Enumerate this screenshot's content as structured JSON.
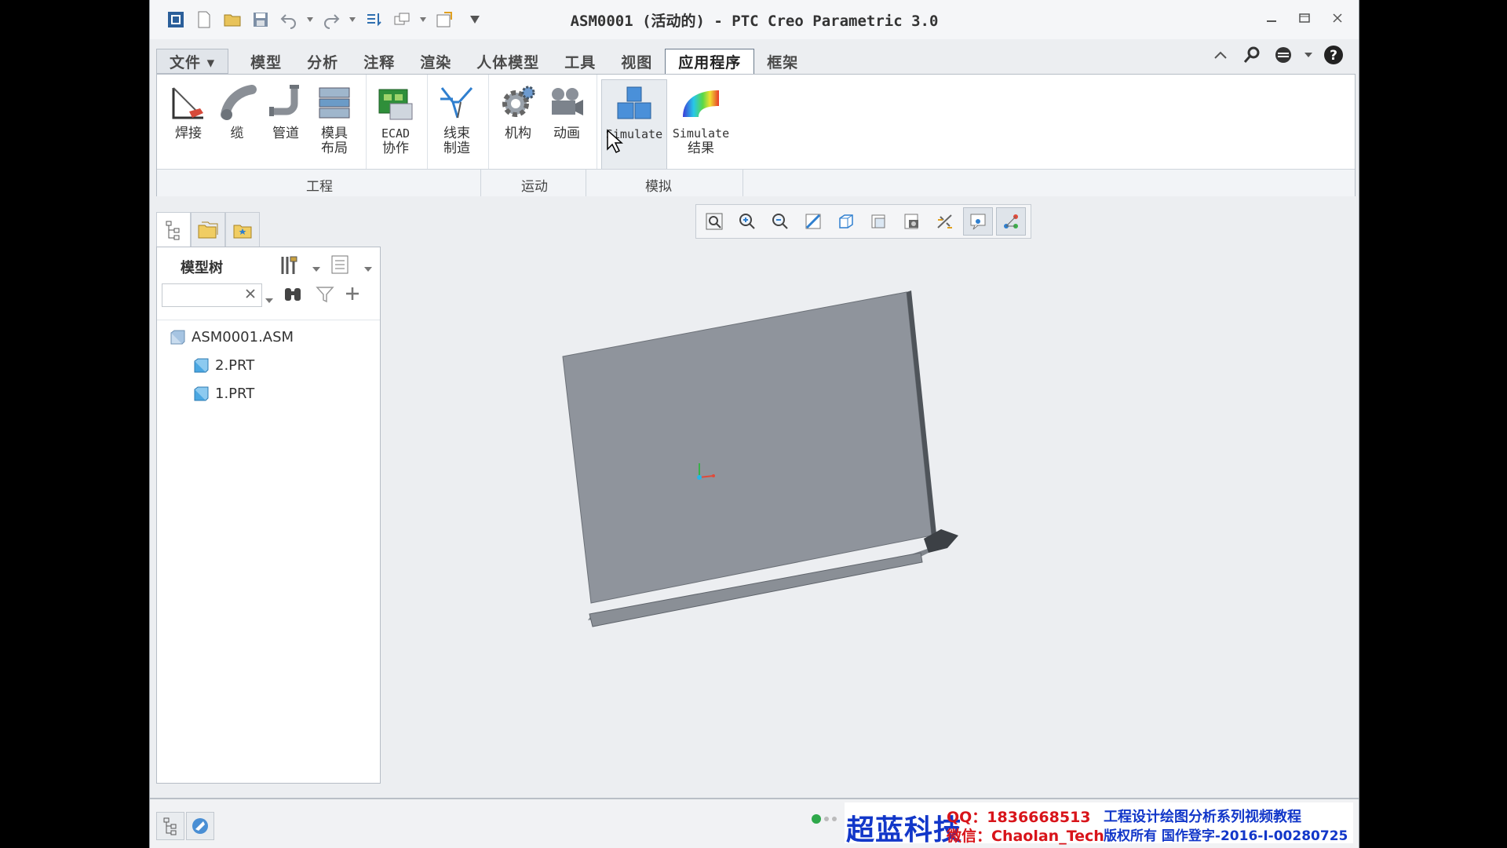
{
  "window": {
    "title": "ASM0001 (活动的) - PTC Creo Parametric 3.0"
  },
  "tabs": [
    {
      "label": "文件 ▾"
    },
    {
      "label": "模型"
    },
    {
      "label": "分析"
    },
    {
      "label": "注释"
    },
    {
      "label": "渲染"
    },
    {
      "label": "人体模型"
    },
    {
      "label": "工具"
    },
    {
      "label": "视图"
    },
    {
      "label": "应用程序"
    },
    {
      "label": "框架"
    }
  ],
  "active_tab": "应用程序",
  "ribbon": {
    "buttons": [
      {
        "line1": "焊接",
        "line2": ""
      },
      {
        "line1": "缆",
        "line2": ""
      },
      {
        "line1": "管道",
        "line2": ""
      },
      {
        "line1": "模具",
        "line2": "布局"
      },
      {
        "line1": "ECAD",
        "line2": "协作"
      },
      {
        "line1": "线束",
        "line2": "制造"
      },
      {
        "line1": "机构",
        "line2": ""
      },
      {
        "line1": "动画",
        "line2": ""
      },
      {
        "line1": "Simulate",
        "line2": ""
      },
      {
        "line1": "Simulate",
        "line2": "结果"
      }
    ],
    "groups": [
      {
        "label": "工程"
      },
      {
        "label": "运动"
      },
      {
        "label": "模拟"
      }
    ]
  },
  "navigator": {
    "header": "模型树",
    "search_value": "",
    "tree": [
      {
        "label": "ASM0001.ASM"
      },
      {
        "label": "2.PRT"
      },
      {
        "label": "1.PRT"
      }
    ]
  },
  "colors": {
    "part_face": "#8f949c",
    "part_edge": "#5f646b",
    "accent_blue": "#2f7fcf"
  },
  "watermark": {
    "brand": "超蓝科技",
    "qq": "QQ：1836668513",
    "wechat": "微信：Chaolan_Tech",
    "tagline": "工程设计绘图分析系列视频教程",
    "copyright": "版权所有  国作登字-2016-I-00280725"
  }
}
